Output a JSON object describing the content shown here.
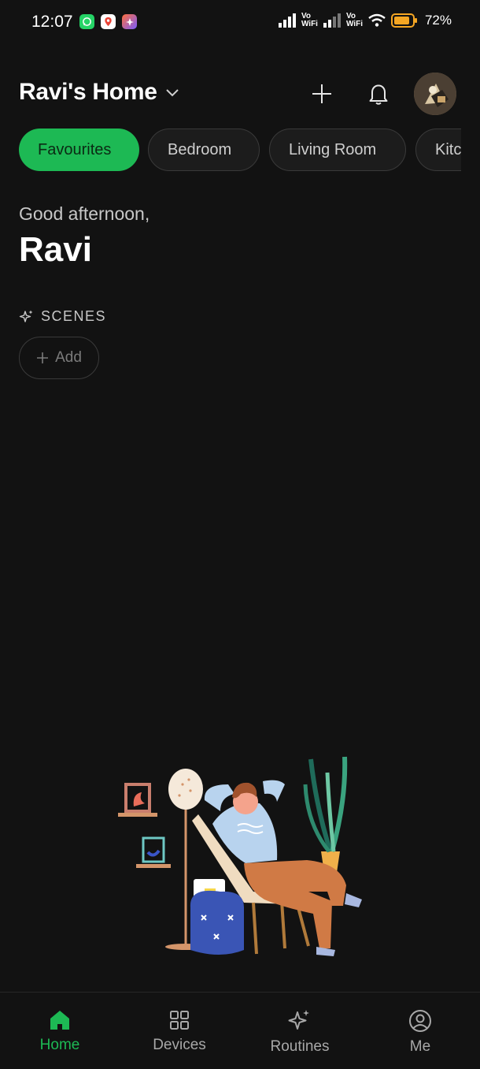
{
  "status_bar": {
    "time": "12:07",
    "battery": "72%",
    "vowifi_top": "Vo",
    "vowifi_bottom": "WiFi",
    "app_icons": [
      "whatsapp-icon",
      "maps-icon",
      "app-icon"
    ]
  },
  "header": {
    "home_name": "Ravi's Home",
    "add_icon": "plus-icon",
    "bell_icon": "bell-icon"
  },
  "tabs": [
    {
      "label": "Favourites",
      "active": true
    },
    {
      "label": "Bedroom",
      "active": false
    },
    {
      "label": "Living Room",
      "active": false
    },
    {
      "label": "Kitc",
      "active": false
    }
  ],
  "greeting": {
    "line1": "Good afternoon,",
    "name": "Ravi"
  },
  "scenes": {
    "title": "SCENES",
    "add_label": "Add"
  },
  "bottom_nav": {
    "items": [
      {
        "label": "Home",
        "icon": "home-icon",
        "active": true
      },
      {
        "label": "Devices",
        "icon": "grid-icon",
        "active": false
      },
      {
        "label": "Routines",
        "icon": "sparkle-icon",
        "active": false
      },
      {
        "label": "Me",
        "icon": "person-icon",
        "active": false
      }
    ]
  },
  "colors": {
    "accent": "#1db954",
    "background": "#121212"
  }
}
